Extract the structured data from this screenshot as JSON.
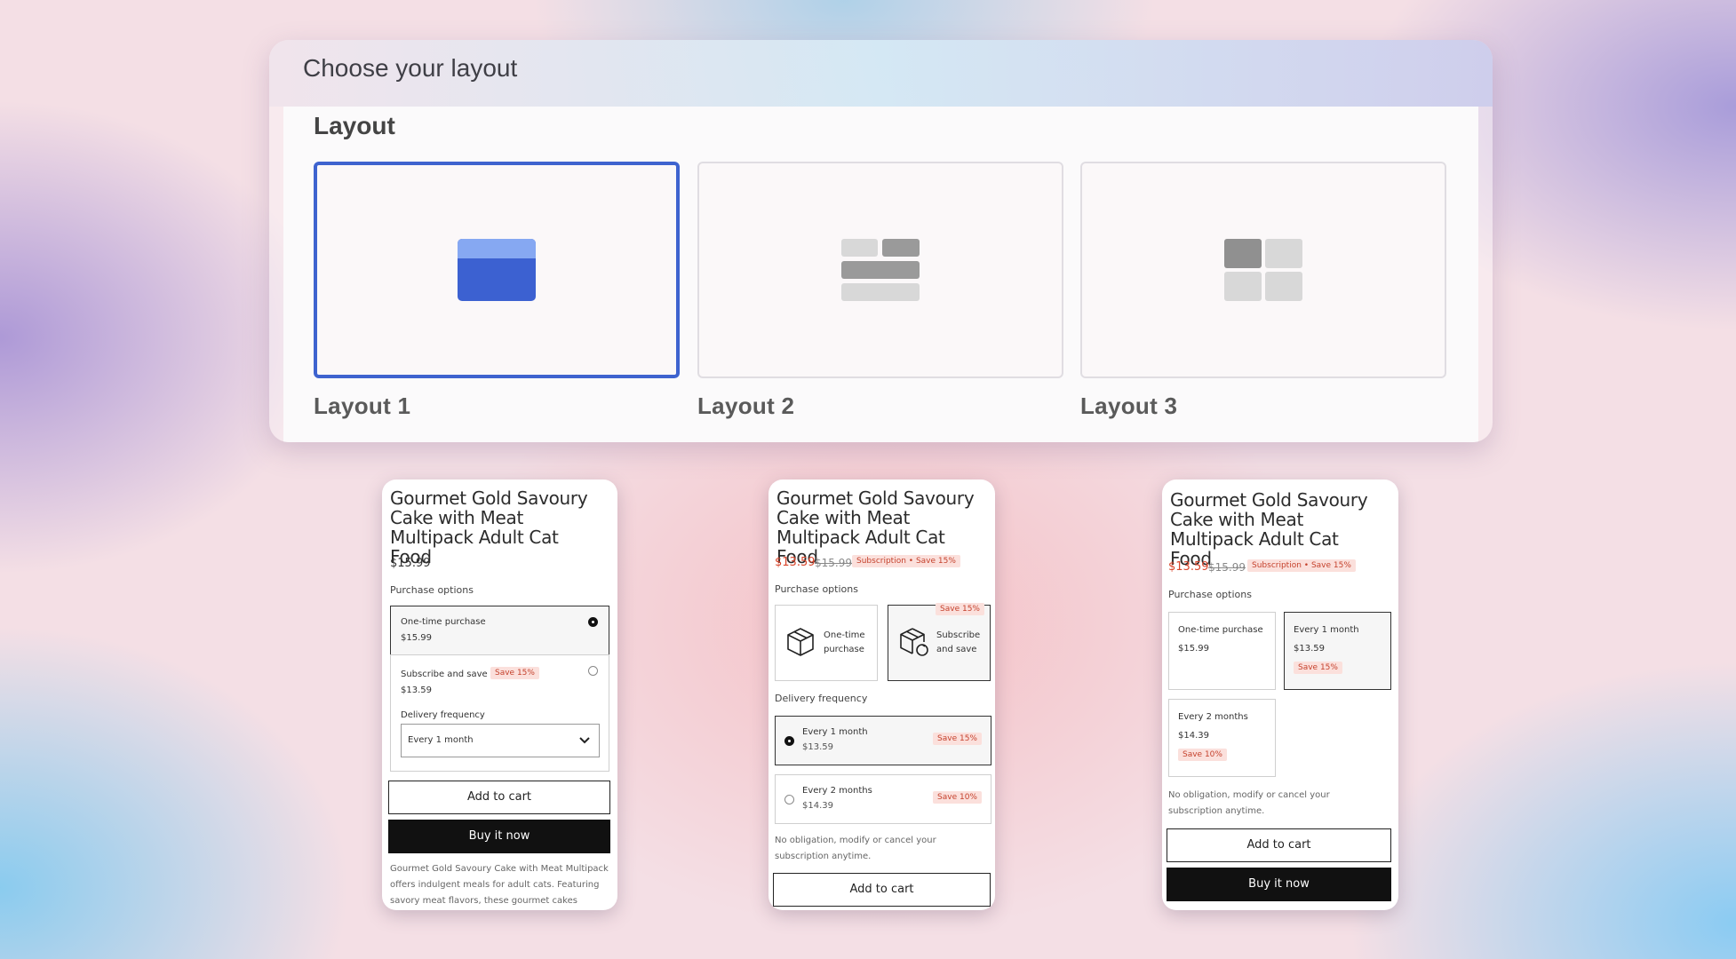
{
  "panel": {
    "title": "Choose your layout",
    "section_title": "Layout",
    "layouts": [
      {
        "label": "Layout 1",
        "selected": true
      },
      {
        "label": "Layout 2",
        "selected": false
      },
      {
        "label": "Layout 3",
        "selected": false
      }
    ]
  },
  "colors": {
    "accent": "#3e63cf",
    "sale": "#d9452b",
    "badge_bg": "#fbe0dc"
  },
  "product": {
    "title": "Gourmet Gold Savoury Cake with Meat Multipack Adult Cat Food",
    "price": "$15.99",
    "sale_price": "$13.59",
    "original_price": "$15.99",
    "subscription_badge": "Subscription • Save 15%",
    "purchase_options_label": "Purchase options",
    "delivery_frequency_label": "Delivery frequency",
    "add_to_cart": "Add to cart",
    "buy_now": "Buy it now",
    "no_obligation": "No obligation, modify or cancel your subscription anytime.",
    "description": "Gourmet Gold Savoury Cake with Meat Multipack offers indulgent meals for adult cats. Featuring savory meat flavors, these gourmet cakes provide"
  },
  "mock1": {
    "one_time_label": "One-time purchase",
    "one_time_price": "$15.99",
    "subscribe_label": "Subscribe and save",
    "subscribe_badge": "Save 15%",
    "subscribe_price": "$13.59",
    "frequency_value": "Every 1 month"
  },
  "mock2": {
    "one_time_line1": "One-time",
    "one_time_line2": "purchase",
    "subscribe_line1": "Subscribe",
    "subscribe_line2": "and save",
    "subscribe_badge": "Save 15%",
    "freq1_label": "Every 1 month",
    "freq1_price": "$13.59",
    "freq1_badge": "Save 15%",
    "freq2_label": "Every 2 months",
    "freq2_price": "$14.39",
    "freq2_badge": "Save 10%"
  },
  "mock3": {
    "one_time_label": "One-time purchase",
    "one_time_price": "$15.99",
    "month1_label": "Every 1 month",
    "month1_price": "$13.59",
    "month1_badge": "Save 15%",
    "month2_label": "Every 2 months",
    "month2_price": "$14.39",
    "month2_badge": "Save 10%"
  }
}
